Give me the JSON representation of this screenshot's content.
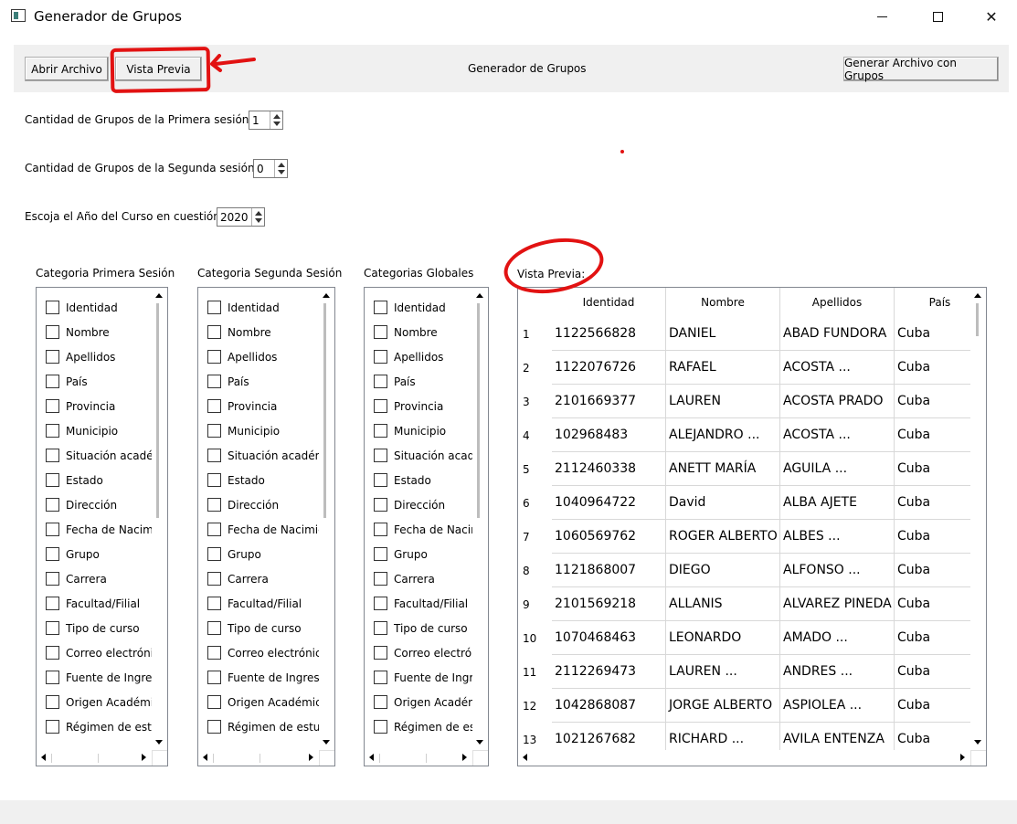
{
  "window": {
    "title": "Generador de Grupos",
    "minimize_icon": "minimize-icon",
    "maximize_icon": "maximize-icon",
    "close_icon": "close-icon",
    "close_glyph": "✕"
  },
  "toolbar": {
    "open_label": "Abrir Archivo",
    "preview_label": "Vista Previa",
    "title": "Generador de Grupos",
    "generate_label": "Generar Archivo con Grupos"
  },
  "settings": {
    "first_session_label": "Cantidad de Grupos de la Primera sesión:",
    "first_session_value": "1",
    "second_session_label": "Cantidad de Grupos de la Segunda sesión:",
    "second_session_value": "0",
    "year_label": "Escoja el Año del Curso en cuestión:",
    "year_value": "2020"
  },
  "lists": [
    {
      "title": "Categoria Primera Sesión",
      "items": [
        "Identidad",
        "Nombre",
        "Apellidos",
        "País",
        "Provincia",
        "Municipio",
        "Situación académica",
        "Estado",
        "Dirección",
        "Fecha de Nacimiento",
        "Grupo",
        "Carrera",
        "Facultad/Filial",
        "Tipo de curso",
        "Correo electrónico",
        "Fuente de Ingreso",
        "Origen Académico",
        "Régimen de estudio"
      ]
    },
    {
      "title": "Categoria Segunda Sesión",
      "items": [
        "Identidad",
        "Nombre",
        "Apellidos",
        "País",
        "Provincia",
        "Municipio",
        "Situación académica",
        "Estado",
        "Dirección",
        "Fecha de Nacimiento",
        "Grupo",
        "Carrera",
        "Facultad/Filial",
        "Tipo de curso",
        "Correo electrónico",
        "Fuente de Ingreso",
        "Origen Académico",
        "Régimen de estudio"
      ]
    },
    {
      "title": "Categorias Globales",
      "items": [
        "Identidad",
        "Nombre",
        "Apellidos",
        "País",
        "Provincia",
        "Municipio",
        "Situación académica",
        "Estado",
        "Dirección",
        "Fecha de Nacimiento",
        "Grupo",
        "Carrera",
        "Facultad/Filial",
        "Tipo de curso",
        "Correo electrónico",
        "Fuente de Ingreso",
        "Origen Académico",
        "Régimen de estudio"
      ]
    }
  ],
  "preview": {
    "label": "Vista Previa:",
    "columns": [
      "Identidad",
      "Nombre",
      "Apellidos",
      "País"
    ],
    "rows": [
      {
        "n": "1",
        "id": "1122566828",
        "nombre": "DANIEL",
        "apellidos": "ABAD FUNDORA",
        "pais": "Cuba"
      },
      {
        "n": "2",
        "id": "1122076726",
        "nombre": "RAFAEL",
        "apellidos": "ACOSTA ...",
        "pais": "Cuba"
      },
      {
        "n": "3",
        "id": "2101669377",
        "nombre": "LAUREN",
        "apellidos": "ACOSTA PRADO",
        "pais": "Cuba"
      },
      {
        "n": "4",
        "id": "102968483",
        "nombre": "ALEJANDRO ...",
        "apellidos": "ACOSTA ...",
        "pais": "Cuba"
      },
      {
        "n": "5",
        "id": "2112460338",
        "nombre": "ANETT MARÍA",
        "apellidos": "AGUILA ...",
        "pais": "Cuba"
      },
      {
        "n": "6",
        "id": "1040964722",
        "nombre": "David",
        "apellidos": "ALBA AJETE",
        "pais": "Cuba"
      },
      {
        "n": "7",
        "id": "1060569762",
        "nombre": "ROGER ALBERTO",
        "apellidos": "ALBES ...",
        "pais": "Cuba"
      },
      {
        "n": "8",
        "id": "1121868007",
        "nombre": "DIEGO",
        "apellidos": "ALFONSO ...",
        "pais": "Cuba"
      },
      {
        "n": "9",
        "id": "2101569218",
        "nombre": "ALLANIS",
        "apellidos": "ALVAREZ PINEDA",
        "pais": "Cuba"
      },
      {
        "n": "10",
        "id": "1070468463",
        "nombre": "LEONARDO",
        "apellidos": "AMADO ...",
        "pais": "Cuba"
      },
      {
        "n": "11",
        "id": "2112269473",
        "nombre": "LAUREN ...",
        "apellidos": "ANDRES ...",
        "pais": "Cuba"
      },
      {
        "n": "12",
        "id": "1042868087",
        "nombre": "JORGE ALBERTO",
        "apellidos": "ASPIOLEA ...",
        "pais": "Cuba"
      },
      {
        "n": "13",
        "id": "1021267682",
        "nombre": "RICHARD ...",
        "apellidos": "AVILA ENTENZA",
        "pais": "Cuba"
      }
    ]
  },
  "annotations": {
    "color": "#e21212"
  }
}
